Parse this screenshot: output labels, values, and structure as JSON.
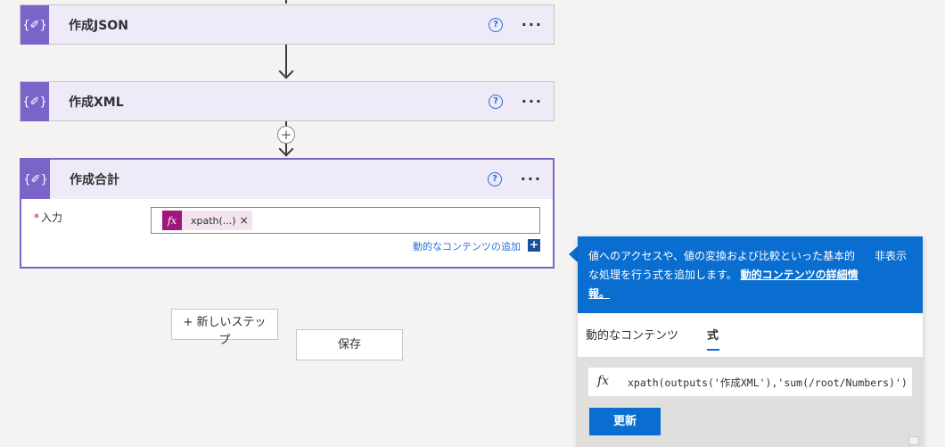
{
  "flow": {
    "cards": [
      {
        "title": "作成JSON",
        "icon": "compose-braces-icon",
        "help": "?",
        "more": "···"
      },
      {
        "title": "作成XML",
        "icon": "compose-braces-icon",
        "help": "?",
        "more": "···"
      },
      {
        "title": "作成合計",
        "icon": "compose-braces-icon",
        "help": "?",
        "more": "···"
      }
    ],
    "selected_card": {
      "field_label": "入力",
      "required_marker": "*",
      "token_icon": "fx",
      "token_text": "xpath(...)",
      "token_close": "×",
      "dynamic_content_link": "動的なコンテンツの追加",
      "dynamic_add": "+"
    },
    "buttons": {
      "new_step": "+ 新しいステップ",
      "save": "保存"
    }
  },
  "popup": {
    "description": "値へのアクセスや、値の変換および比較といった基本的な処理を行う式を追加します。",
    "learn_more": "動的コンテンツの詳細情報。",
    "hide": "非表示",
    "tabs": [
      "動的なコンテンツ",
      "式"
    ],
    "active_tab": "式",
    "expression_icon": "fx",
    "expression": "xpath(outputs('作成XML'),'sum(/root/Numbers)')",
    "update_button": "更新"
  },
  "colors": {
    "card_accent": "#7b64c9",
    "card_bg": "#eeeaf8",
    "popup_blue": "#0a6ed1",
    "token_magenta": "#a0177b"
  }
}
